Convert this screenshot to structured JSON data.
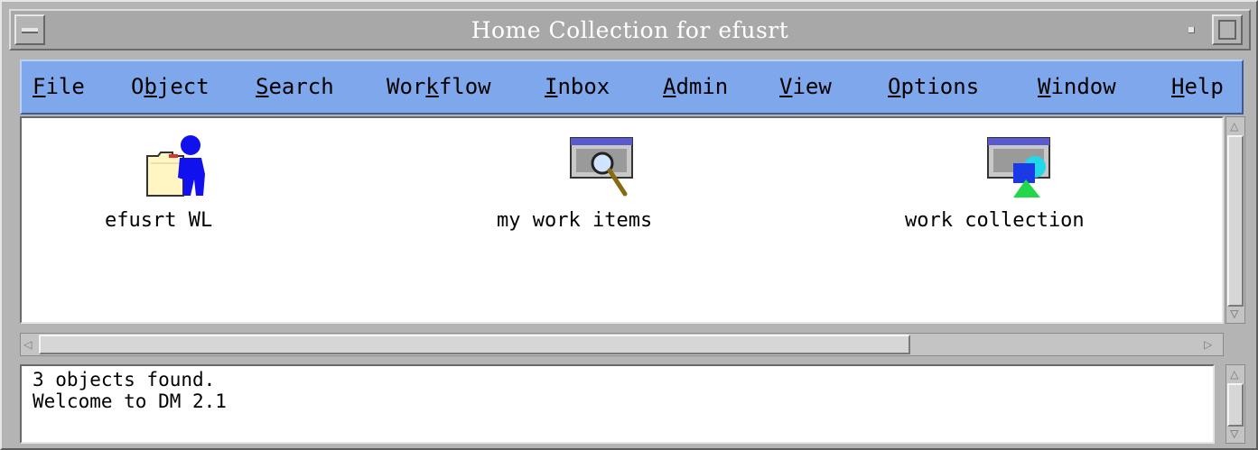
{
  "window": {
    "title": "Home Collection for efusrt"
  },
  "menubar": {
    "items": [
      {
        "pre": "",
        "key": "F",
        "post": "ile"
      },
      {
        "pre": "O",
        "key": "b",
        "post": "ject"
      },
      {
        "pre": "",
        "key": "S",
        "post": "earch"
      },
      {
        "pre": "Wor",
        "key": "k",
        "post": "flow"
      },
      {
        "pre": "",
        "key": "I",
        "post": "nbox"
      },
      {
        "pre": "",
        "key": "A",
        "post": "dmin"
      },
      {
        "pre": "",
        "key": "V",
        "post": "iew"
      },
      {
        "pre": "",
        "key": "O",
        "post": "ptions"
      },
      {
        "pre": "",
        "key": "W",
        "post": "indow"
      },
      {
        "pre": "",
        "key": "H",
        "post": "elp"
      }
    ]
  },
  "collection": {
    "items": [
      {
        "label": "efusrt WL",
        "icon": "worklist-person-folder-icon"
      },
      {
        "label": "my work items",
        "icon": "search-query-window-icon"
      },
      {
        "label": "work collection",
        "icon": "collection-shapes-window-icon"
      }
    ]
  },
  "status": {
    "lines": [
      "3 objects found.",
      "Welcome to DM 2.1"
    ]
  },
  "colors": {
    "menubar": "#7fa7ec",
    "titlebar": "#a8a8a8",
    "person": "#1111ee",
    "shape_blue": "#1a3ae8",
    "shape_cyan": "#22d8e8",
    "shape_green": "#22d84a"
  }
}
